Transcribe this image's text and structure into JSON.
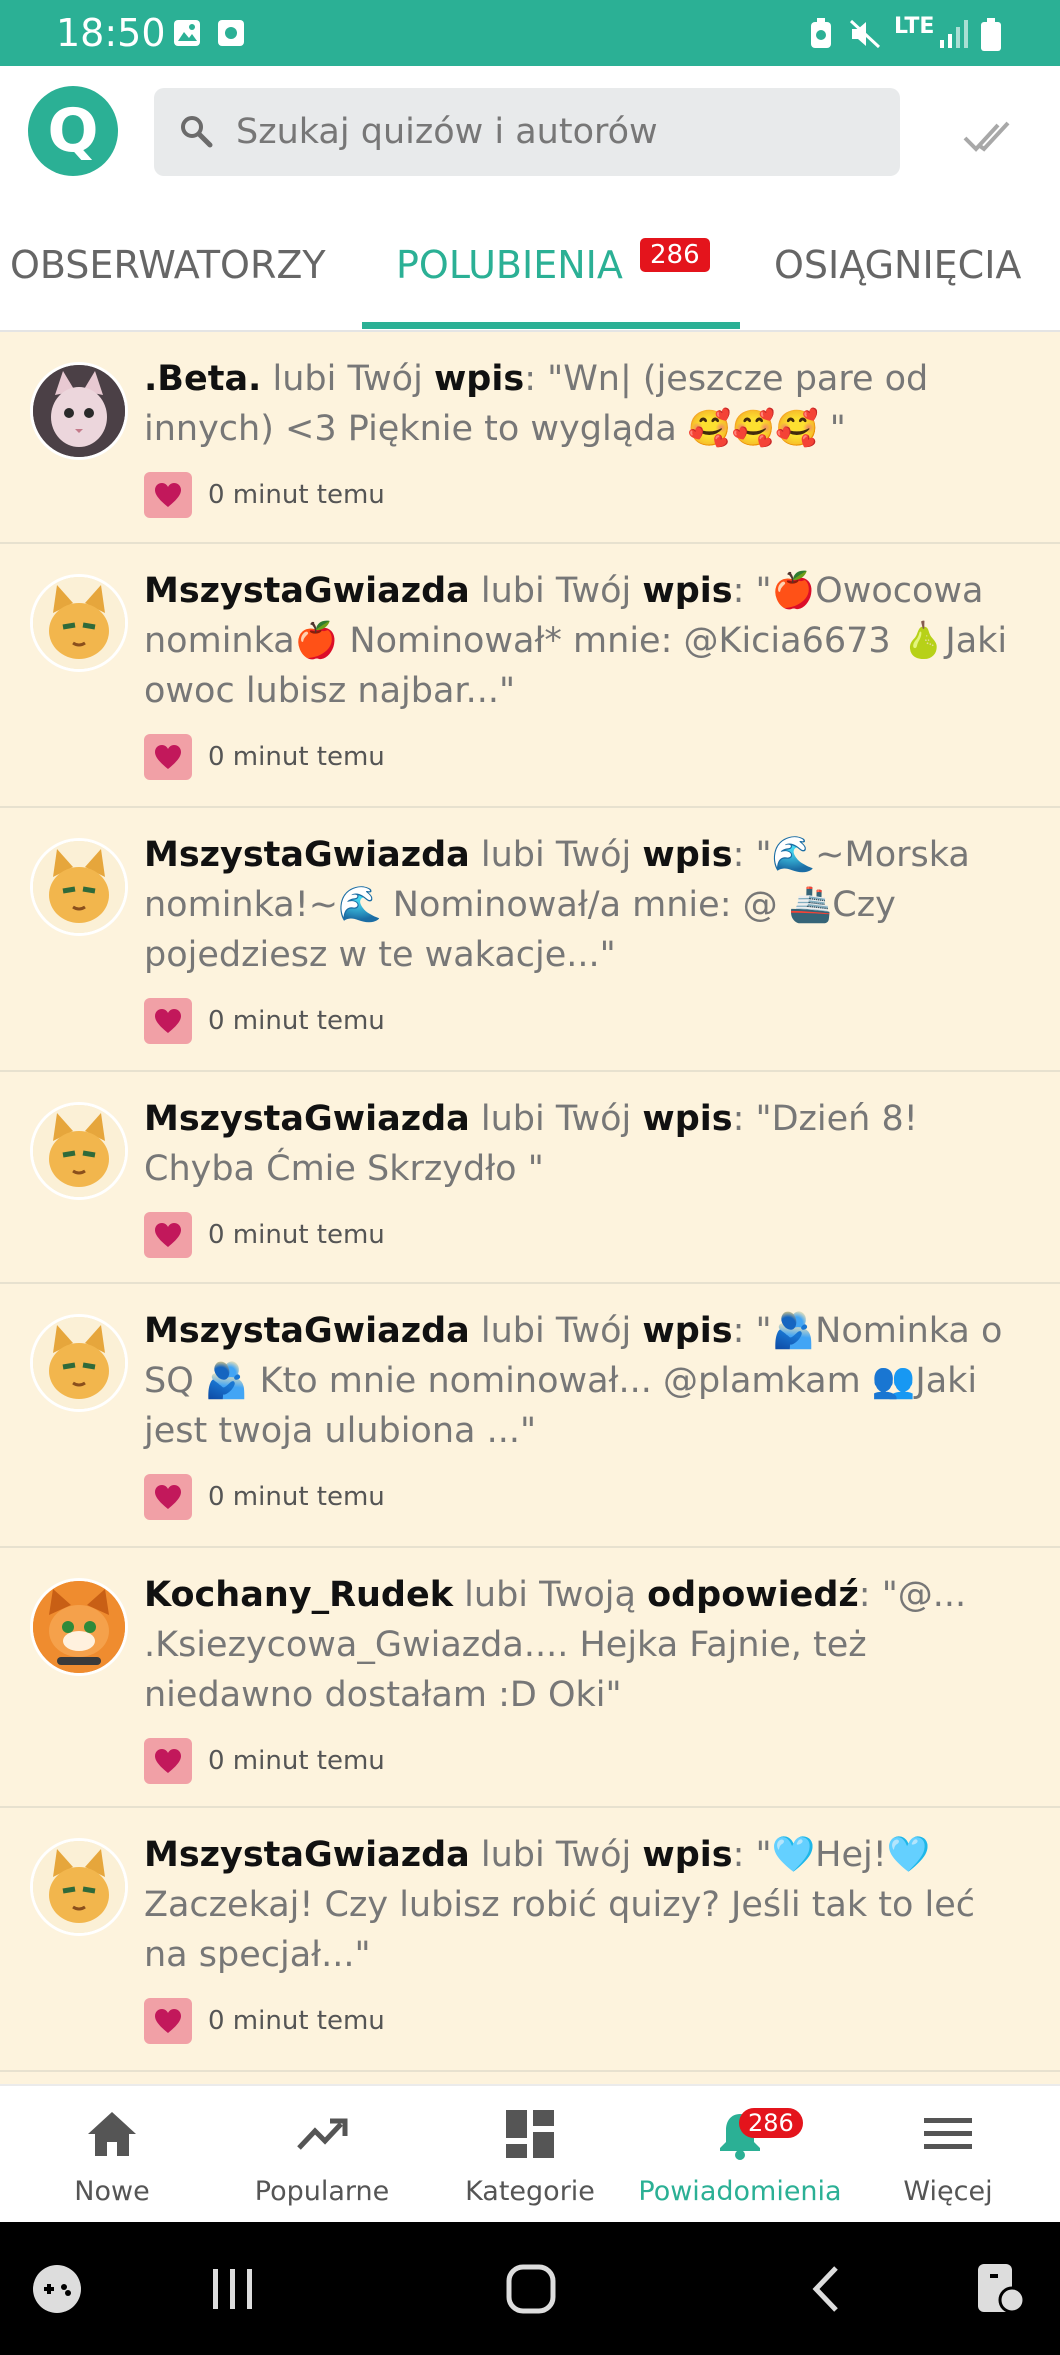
{
  "status_bar": {
    "time": "18:50",
    "network": "LTE",
    "icons": [
      "image-icon",
      "app-icon",
      "battery-saver-icon",
      "mute-icon",
      "signal-icon",
      "battery-icon"
    ]
  },
  "header": {
    "logo": "Q",
    "search_placeholder": "Szukaj quizów i autorów",
    "mark_read_icon": "double-check-icon"
  },
  "tabs": [
    {
      "label": "OBSERWATORZY",
      "active": false
    },
    {
      "label": "POLUBIENIA",
      "active": true,
      "badge": "286"
    },
    {
      "label": "OSIĄGNIĘCIA",
      "active": false
    }
  ],
  "notifications": [
    {
      "user": ".Beta.",
      "verb": "lubi Twój",
      "object": "wpis",
      "quote": ": \"Wn| (jeszcze pare od innych) <3 Pięknie to wygląda 🥰🥰🥰 \"",
      "time": "0 minut temu",
      "avatar": "beta"
    },
    {
      "user": "MszystaGwiazda",
      "verb": "lubi Twój",
      "object": "wpis",
      "quote": ": \"🍎Owocowa nominka🍎 Nominował* mnie: @Kicia6673 🍐Jaki owoc lubisz najbar...\"",
      "time": "0 minut temu",
      "avatar": "cat"
    },
    {
      "user": "MszystaGwiazda",
      "verb": "lubi Twój",
      "object": "wpis",
      "quote": ": \"🌊~Morska nominka!~🌊 Nominował/a mnie: @ 🚢Czy pojedziesz w te wakacje...\"",
      "time": "0 minut temu",
      "avatar": "cat"
    },
    {
      "user": "MszystaGwiazda",
      "verb": "lubi Twój",
      "object": "wpis",
      "quote": ": \"Dzień 8! Chyba Ćmie Skrzydło \"",
      "time": "0 minut temu",
      "avatar": "cat"
    },
    {
      "user": "MszystaGwiazda",
      "verb": "lubi Twój",
      "object": "wpis",
      "quote": ": \"🫂Nominka o SQ 🫂 Kto mnie nominował... @plamkam 👥Jaki jest twoja ulubiona ...\"",
      "time": "0 minut temu",
      "avatar": "cat"
    },
    {
      "user": "Kochany_Rudek",
      "verb": "lubi Twoją",
      "object": "odpowiedź",
      "quote": ": \"@... .Ksiezycowa_Gwiazda.... Hejka Fajnie, też niedawno dostałam :D Oki\"",
      "time": "0 minut temu",
      "avatar": "rudek"
    },
    {
      "user": "MszystaGwiazda",
      "verb": "lubi Twój",
      "object": "wpis",
      "quote": ": \"🩵Hej!🩵 Zaczekaj! Czy lubisz robić quizy? Jeśli tak to leć na specjał...\"",
      "time": "0 minut temu",
      "avatar": "cat"
    }
  ],
  "bottom_nav": [
    {
      "label": "Nowe",
      "icon": "home-icon"
    },
    {
      "label": "Popularne",
      "icon": "trending-icon"
    },
    {
      "label": "Kategorie",
      "icon": "dashboard-icon"
    },
    {
      "label": "Powiadomienia",
      "icon": "bell-icon",
      "badge": "286",
      "active": true
    },
    {
      "label": "Więcej",
      "icon": "menu-icon"
    }
  ],
  "colors": {
    "accent": "#2bb095",
    "badge": "#e4141c",
    "item_bg": "#fdf3dd",
    "heart": "#c2185b"
  }
}
